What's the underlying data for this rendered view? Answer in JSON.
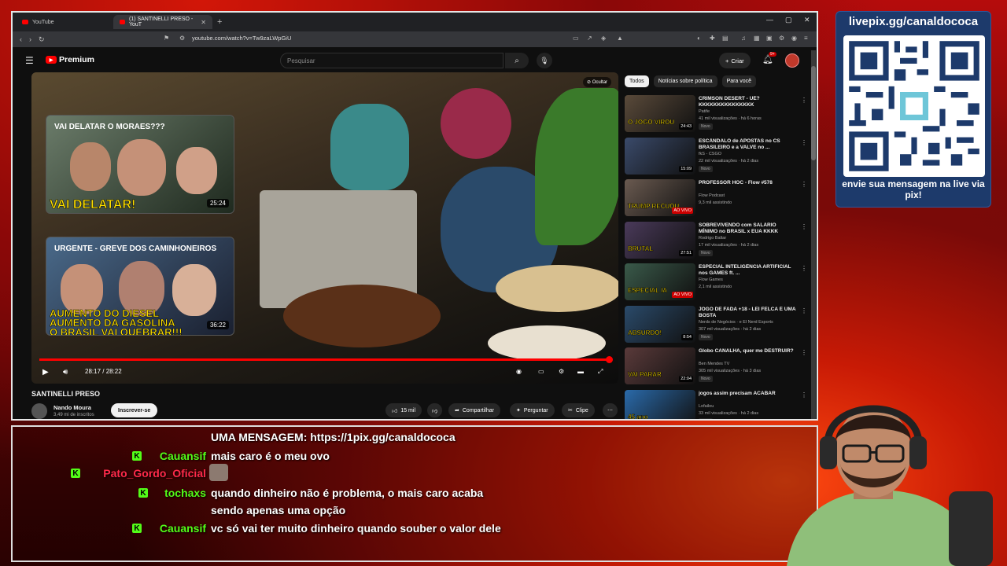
{
  "browser": {
    "tabs": [
      {
        "label": "YouTube"
      },
      {
        "label": "(1) SANTINELLI PRESO - YouT"
      }
    ],
    "url": "youtube.com/watch?v=Tw9zaLWpGiU"
  },
  "youtube": {
    "logo_text": "Premium",
    "search_placeholder": "Pesquisar",
    "create_label": "Criar",
    "notif_count": "9+"
  },
  "player": {
    "hide_label": "Ocultar",
    "time": "28:17 / 28:22",
    "progress_fraction": 0.997,
    "end_thumbs": [
      {
        "title": "VAI DELATAR O MORAES???",
        "overlay": "VAI DELATAR!",
        "duration": "25:24"
      },
      {
        "title": "URGENTE - GREVE DOS CAMINHONEIROS",
        "overlay_lines": [
          "AUMENTO DO DIESEL",
          "AUMENTO DA GASOLINA",
          "O BRASIL VAI QUEBRAR!!!"
        ],
        "duration": "36:22"
      }
    ]
  },
  "video": {
    "title": "SANTINELLI PRESO",
    "channel": "Nando Moura",
    "subscribers": "3,49 mi de inscritos",
    "subscribe_label": "Inscrever-se",
    "likes": "15 mil",
    "share_label": "Compartilhar",
    "ask_label": "Perguntar",
    "clip_label": "Clipe"
  },
  "chips": [
    {
      "label": "Todos"
    },
    {
      "label": "Notícias sobre política"
    },
    {
      "label": "Para você"
    }
  ],
  "recommendations": [
    {
      "title": "CRIMSON DESERT - UÉ? KKKKKKKKKKKKKKK",
      "channel": "Patife",
      "meta": "41 mil visualizações · há 6 horas",
      "badge": "Novo",
      "duration": "24:43",
      "color": "#5a4a3a",
      "thumb_text": "O JOGO VIROU"
    },
    {
      "title": "ESCÂNDALO de APOSTAS no CS BRASILEIRO e a VALVE no ...",
      "channel": "fkS - CSGO",
      "meta": "22 mil visualizações · há 2 dias",
      "badge": "Novo",
      "duration": "15:09",
      "color": "#3a4a6a",
      "thumb_text": ""
    },
    {
      "title": "PROFESSOR HOC - Flow #578",
      "channel": "Flow Podcast",
      "meta": "9,3 mil assistindo",
      "badge": "",
      "duration": "AO VIVO",
      "color": "#6a5a50",
      "thumb_text": "TRUMP RECUOU"
    },
    {
      "title": "SOBREVIVENDO com SALÁRIO MÍNIMO no BRASIL x EUA KKKK",
      "channel": "Rodrigo Baltar",
      "meta": "17 mil visualizações · há 2 dias",
      "badge": "Novo",
      "duration": "27:51",
      "color": "#4a3a5a",
      "thumb_text": "BRUTAL"
    },
    {
      "title": "ESPECIAL INTELIGÊNCIA ARTIFICIAL nos GAMES ft. ...",
      "channel": "Flow Games",
      "meta": "2,1 mil assistindo",
      "badge": "",
      "duration": "AO VIVO",
      "color": "#3a5a4a",
      "thumb_text": "ESPECIAL IA"
    },
    {
      "title": "JOGO DE FADA +18 - LEI FELCA É UMA BOSTA",
      "channel": "Nerds de Negócios · e El Nerd Esports",
      "meta": "307 mil visualizações · há 2 dias",
      "badge": "Novo",
      "duration": "8:54",
      "color": "#2a4a6a",
      "thumb_text": "ABSURDO!"
    },
    {
      "title": "Globo CANALHA, quer me DESTRUIR?",
      "channel": "Ben Mendes TV",
      "meta": "305 mil visualizações · há 3 dias",
      "badge": "Novo",
      "duration": "22:04",
      "color": "#5a3a3a",
      "thumb_text": "VAI PARAR"
    },
    {
      "title": "jogos assim precisam ACABAR",
      "channel": "Lofailou",
      "meta": "33 mil visualizações · há 2 dias",
      "badge": "Novo",
      "duration": "",
      "color": "#2a6aaa",
      "thumb_text": "45 ano"
    }
  ],
  "overlay": {
    "qr_url": "livepix.gg/canaldococa",
    "qr_cta": "envie sua mensagem na live via pix!"
  },
  "chat": {
    "headline": "UMA MENSAGEM: https://1pix.gg/canaldococa",
    "messages": [
      {
        "user": "Cauansif",
        "text": "mais caro é o meu ovo",
        "color": "#53fc18",
        "badge": "K"
      },
      {
        "user": "Pato_Gordo_Oficial",
        "text": "",
        "color": "#ff2a4a",
        "badge": "K"
      },
      {
        "user": "tochaxs",
        "text": "quando dinheiro não é problema, o mais caro acaba sendo apenas uma opção",
        "color": "#53fc18",
        "badge": "K"
      },
      {
        "user": "Cauansif",
        "text": "vc só vai ter muito dinheiro quando souber o valor dele",
        "color": "#53fc18",
        "badge": "K"
      }
    ]
  }
}
